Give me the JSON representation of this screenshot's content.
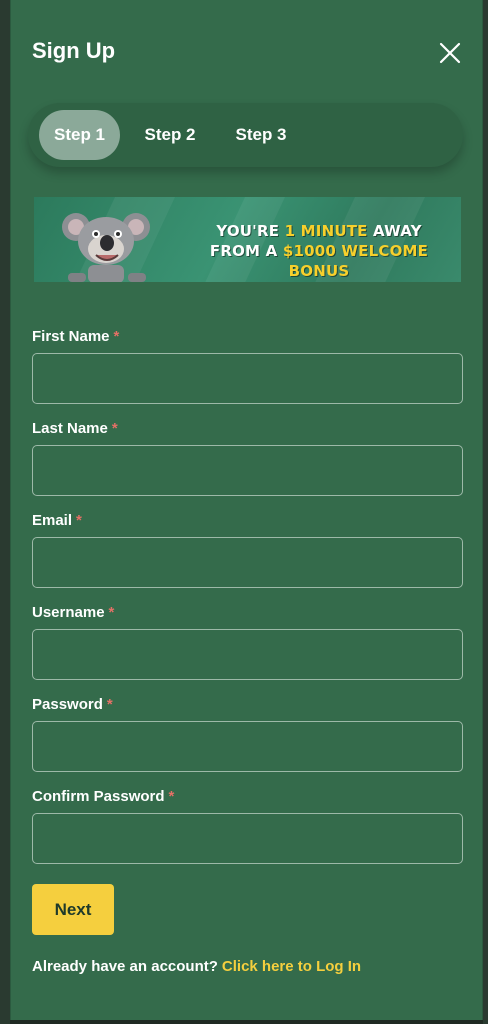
{
  "modal": {
    "title": "Sign Up"
  },
  "steps": [
    {
      "label": "Step 1",
      "active": true
    },
    {
      "label": "Step 2",
      "active": false
    },
    {
      "label": "Step 3",
      "active": false
    }
  ],
  "banner": {
    "line1_part1": "YOU'RE ",
    "line1_highlight": "1 MINUTE",
    "line1_part2": " AWAY",
    "line2_part1": "FROM A ",
    "line2_highlight": "$1000 WELCOME BONUS",
    "mascot": "koala-illustration"
  },
  "form": {
    "fields": [
      {
        "label": "First Name",
        "required_mark": "*",
        "value": ""
      },
      {
        "label": "Last Name",
        "required_mark": "*",
        "value": ""
      },
      {
        "label": "Email",
        "required_mark": "*",
        "value": ""
      },
      {
        "label": "Username",
        "required_mark": "*",
        "value": ""
      },
      {
        "label": "Password",
        "required_mark": "*",
        "value": ""
      },
      {
        "label": "Confirm Password",
        "required_mark": "*",
        "value": ""
      }
    ],
    "next_label": "Next"
  },
  "footer": {
    "prompt": "Already have an account?",
    "link": "Click here to Log In"
  },
  "colors": {
    "modal_bg": "#346b4b",
    "accent": "#f5cf3e",
    "required": "#e57066",
    "active_step": "#8ba999"
  },
  "icons": {
    "close": "close-icon"
  }
}
